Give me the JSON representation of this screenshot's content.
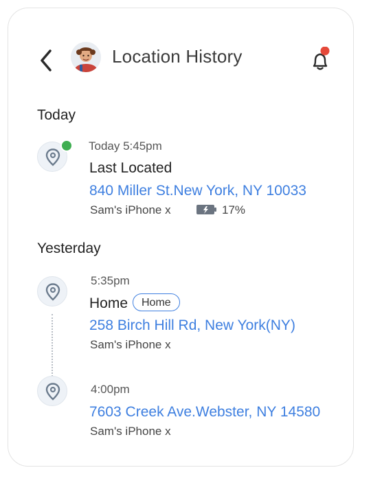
{
  "header": {
    "title": "Location History",
    "notification_badge_color": "#e5493a"
  },
  "today": {
    "label": "Today",
    "entry": {
      "time": "Today 5:45pm",
      "place": "Last Located",
      "address": "840 Miller St.New York, NY 10033",
      "device": "Sam's iPhone x",
      "battery": "17%",
      "status_color": "#3fae51"
    }
  },
  "yesterday": {
    "label": "Yesterday",
    "entries": [
      {
        "time": "5:35pm",
        "place": "Home",
        "tag": "Home",
        "address": "258 Birch Hill Rd, New York(NY)",
        "device": "Sam's iPhone x"
      },
      {
        "time": "4:00pm",
        "address": "7603 Creek Ave.Webster, NY 14580",
        "device": "Sam's iPhone x"
      }
    ]
  },
  "colors": {
    "accent": "#3e7fe0",
    "pin_bg": "#eef2f7",
    "pin_icon": "#6b7b8d"
  }
}
